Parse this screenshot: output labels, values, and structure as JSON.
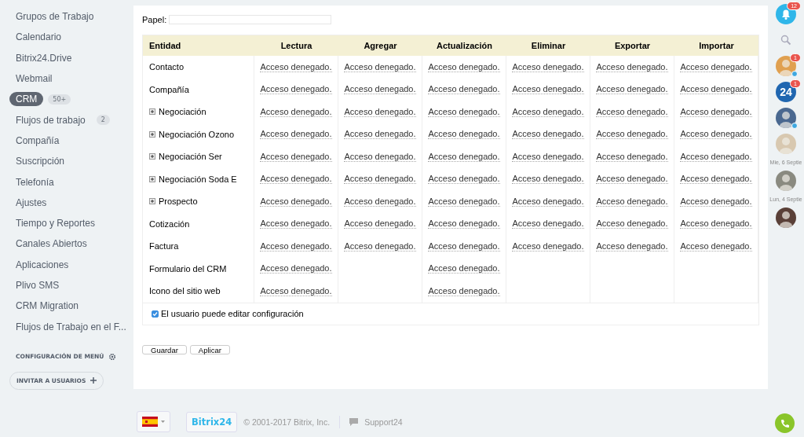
{
  "sidebar": {
    "items": [
      {
        "label": "Grupos de Trabajo",
        "selected": false
      },
      {
        "label": "Calendario",
        "selected": false
      },
      {
        "label": "Bitrix24.Drive",
        "selected": false
      },
      {
        "label": "Webmail",
        "selected": false
      },
      {
        "label": "CRM",
        "selected": true,
        "counter": "50+"
      },
      {
        "label": "Flujos de trabajo",
        "selected": false,
        "counter": "2"
      },
      {
        "label": "Compañía",
        "selected": false
      },
      {
        "label": "Suscripción",
        "selected": false
      },
      {
        "label": "Telefonía",
        "selected": false
      },
      {
        "label": "Ajustes",
        "selected": false
      },
      {
        "label": "Tiempo y Reportes",
        "selected": false
      },
      {
        "label": "Canales Abiertos",
        "selected": false
      },
      {
        "label": "Aplicaciones",
        "selected": false
      },
      {
        "label": "Plivo SMS",
        "selected": false
      },
      {
        "label": "CRM Migration",
        "selected": false
      },
      {
        "label": "Flujos de Trabajo en el F..."
      }
    ],
    "menu_settings": "CONFIGURACIÓN DE MENÚ",
    "invite_button": "INVITAR A USUARIOS"
  },
  "role_field": {
    "label": "Papel:"
  },
  "table": {
    "columns": [
      "Entidad",
      "Lectura",
      "Agregar",
      "Actualización",
      "Eliminar",
      "Exportar",
      "Importar"
    ],
    "rows": [
      {
        "expandable": false,
        "cells": [
          "Contacto",
          "Acceso denegado.",
          "Acceso denegado.",
          "Acceso denegado.",
          "Acceso denegado.",
          "Acceso denegado.",
          "Acceso denegado."
        ]
      },
      {
        "expandable": false,
        "cells": [
          "Compañía",
          "Acceso denegado.",
          "Acceso denegado.",
          "Acceso denegado.",
          "Acceso denegado.",
          "Acceso denegado.",
          "Acceso denegado."
        ]
      },
      {
        "expandable": true,
        "cells": [
          "Negociación",
          "Acceso denegado.",
          "Acceso denegado.",
          "Acceso denegado.",
          "Acceso denegado.",
          "Acceso denegado.",
          "Acceso denegado."
        ]
      },
      {
        "expandable": true,
        "cells": [
          "Negociación Ozono",
          "Acceso denegado.",
          "Acceso denegado.",
          "Acceso denegado.",
          "Acceso denegado.",
          "Acceso denegado.",
          "Acceso denegado."
        ]
      },
      {
        "expandable": true,
        "cells": [
          "Negociación Ser",
          "Acceso denegado.",
          "Acceso denegado.",
          "Acceso denegado.",
          "Acceso denegado.",
          "Acceso denegado.",
          "Acceso denegado."
        ]
      },
      {
        "expandable": true,
        "cells": [
          "Negociación Soda E",
          "Acceso denegado.",
          "Acceso denegado.",
          "Acceso denegado.",
          "Acceso denegado.",
          "Acceso denegado.",
          "Acceso denegado."
        ]
      },
      {
        "expandable": true,
        "cells": [
          "Prospecto",
          "Acceso denegado.",
          "Acceso denegado.",
          "Acceso denegado.",
          "Acceso denegado.",
          "Acceso denegado.",
          "Acceso denegado."
        ]
      },
      {
        "expandable": false,
        "cells": [
          "Cotización",
          "Acceso denegado.",
          "Acceso denegado.",
          "Acceso denegado.",
          "Acceso denegado.",
          "Acceso denegado.",
          "Acceso denegado."
        ]
      },
      {
        "expandable": false,
        "cells": [
          "Factura",
          "Acceso denegado.",
          "Acceso denegado.",
          "Acceso denegado.",
          "Acceso denegado.",
          "Acceso denegado.",
          "Acceso denegado."
        ]
      },
      {
        "expandable": false,
        "cells": [
          "Formulario del CRM",
          "Acceso denegado.",
          null,
          "Acceso denegado.",
          null,
          null,
          null
        ]
      },
      {
        "expandable": false,
        "cells": [
          "Icono del sitio web",
          "Acceso denegado.",
          null,
          "Acceso denegado.",
          null,
          null,
          null
        ]
      }
    ],
    "edit_option": {
      "label": "El usuario puede editar configuración",
      "checked": true
    }
  },
  "buttons": [
    "Guardar",
    "Aplicar"
  ],
  "footer": {
    "logo": "Bitrix24",
    "copyright": "© 2001-2017 Bitrix, Inc.",
    "support": "Support24"
  },
  "right_bar": {
    "notifications": "12",
    "contacts": [
      {
        "kind": "avatar",
        "color": "#e0a050",
        "badge": "1",
        "online": true
      },
      {
        "kind": "logo",
        "text": "24",
        "badge": "1"
      },
      {
        "kind": "avatar",
        "color": "#4a6890",
        "online": true
      },
      {
        "kind": "avatar",
        "color": "#d8c8b0",
        "online": false
      },
      {
        "kind": "date",
        "text": "Mie, 6 Septie"
      },
      {
        "kind": "avatar",
        "color": "#8a8a80",
        "online": false
      },
      {
        "kind": "date",
        "text": "Lun, 4 Septie"
      },
      {
        "kind": "avatar",
        "color": "#5a4038",
        "online": false
      }
    ]
  }
}
